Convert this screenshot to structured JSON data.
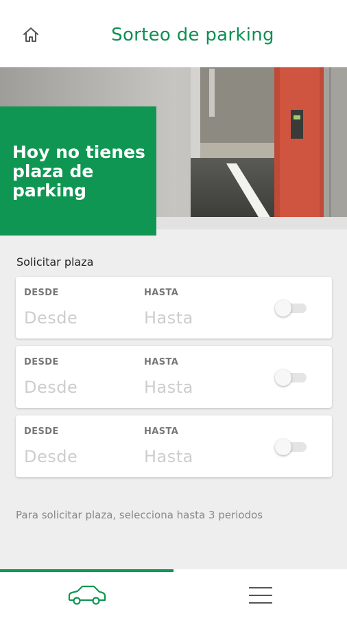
{
  "header": {
    "title": "Sorteo de parking",
    "home_icon": "home-icon"
  },
  "hero": {
    "message": "Hoy no tienes plaza de parking",
    "image": "parking-garage-photo"
  },
  "request_section": {
    "label": "Solicitar plaza",
    "periods": [
      {
        "from_label": "DESDE",
        "from_placeholder": "Desde",
        "to_label": "HASTA",
        "to_placeholder": "Hasta",
        "enabled": false
      },
      {
        "from_label": "DESDE",
        "from_placeholder": "Desde",
        "to_label": "HASTA",
        "to_placeholder": "Hasta",
        "enabled": false
      },
      {
        "from_label": "DESDE",
        "from_placeholder": "Desde",
        "to_label": "HASTA",
        "to_placeholder": "Hasta",
        "enabled": false
      }
    ],
    "hint": "Para solicitar plaza, selecciona hasta 3 periodos"
  },
  "bottom_nav": {
    "items": [
      {
        "icon": "car-icon",
        "active": true
      },
      {
        "icon": "menu-icon",
        "active": false
      }
    ]
  },
  "colors": {
    "brand_green": "#0f9652",
    "title_green": "#0f8f52"
  }
}
